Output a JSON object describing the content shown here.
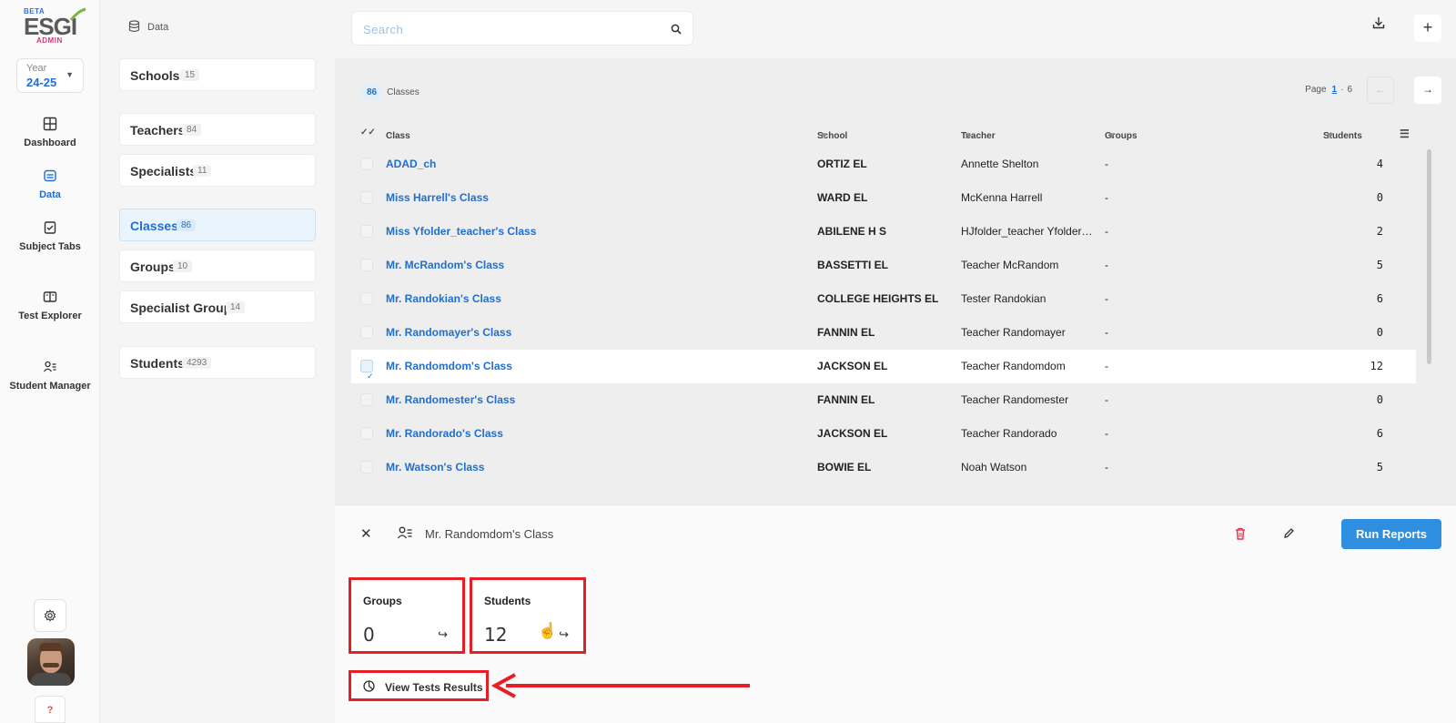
{
  "app": {
    "logo_beta": "BETA",
    "logo_name": "ESGI",
    "logo_admin": "ADMIN",
    "year_label": "Year",
    "year_value": "24-25"
  },
  "nav": {
    "items": [
      {
        "label": "Dashboard",
        "icon": "grid-icon"
      },
      {
        "label": "Data",
        "icon": "data-icon",
        "active": true
      },
      {
        "label": "Subject Tabs",
        "icon": "checklist-icon"
      },
      {
        "label": "Test Explorer",
        "icon": "book-icon"
      },
      {
        "label": "Student Manager",
        "icon": "student-manager-icon"
      }
    ],
    "help_label": "?"
  },
  "data_panel": {
    "title": "Data",
    "items": [
      {
        "label": "Schools",
        "count": "15"
      },
      {
        "label": "Teachers",
        "count": "84"
      },
      {
        "label": "Specialists",
        "count": "11"
      },
      {
        "label": "Classes",
        "count": "86",
        "active": true
      },
      {
        "label": "Groups",
        "count": "10"
      },
      {
        "label": "Specialist Groups",
        "count": "14"
      },
      {
        "label": "Students",
        "count": "4293"
      }
    ]
  },
  "search": {
    "placeholder": "Search"
  },
  "table": {
    "count": "86",
    "count_label": "Classes",
    "page_label": "Page",
    "page_current": "1",
    "page_total": "6",
    "columns": {
      "class": "Class",
      "school": "School",
      "teacher": "Teacher",
      "groups": "Groups",
      "students": "Students"
    },
    "rows": [
      {
        "class": "ADAD_ch",
        "school": "ORTIZ EL",
        "teacher": "Annette Shelton",
        "groups": "-",
        "students": "4"
      },
      {
        "class": "Miss Harrell's Class",
        "school": "WARD EL",
        "teacher": "McKenna Harrell",
        "groups": "-",
        "students": "0"
      },
      {
        "class": "Miss Yfolder_teacher's Class",
        "school": "ABILENE H S",
        "teacher": "HJfolder_teacher Yfolder_teacher",
        "groups": "-",
        "students": "2"
      },
      {
        "class": "Mr. McRandom's Class",
        "school": "BASSETTI EL",
        "teacher": "Teacher McRandom",
        "groups": "-",
        "students": "5"
      },
      {
        "class": "Mr. Randokian's Class",
        "school": "COLLEGE HEIGHTS EL",
        "teacher": "Tester Randokian",
        "groups": "-",
        "students": "6"
      },
      {
        "class": "Mr. Randomayer's Class",
        "school": "FANNIN EL",
        "teacher": "Teacher Randomayer",
        "groups": "-",
        "students": "0"
      },
      {
        "class": "Mr. Randomdom's Class",
        "school": "JACKSON EL",
        "teacher": "Teacher Randomdom",
        "groups": "-",
        "students": "12",
        "selected": true
      },
      {
        "class": "Mr. Randomester's Class",
        "school": "FANNIN EL",
        "teacher": "Teacher Randomester",
        "groups": "-",
        "students": "0"
      },
      {
        "class": "Mr. Randorado's Class",
        "school": "JACKSON EL",
        "teacher": "Teacher Randorado",
        "groups": "-",
        "students": "6"
      },
      {
        "class": "Mr. Watson's Class",
        "school": "BOWIE EL",
        "teacher": "Noah Watson",
        "groups": "-",
        "students": "5"
      }
    ]
  },
  "detail": {
    "title": "Mr. Randomdom's Class",
    "run_reports_label": "Run Reports",
    "groups_label": "Groups",
    "groups_value": "0",
    "students_label": "Students",
    "students_value": "12",
    "view_results_label": "View Tests Results"
  },
  "colors": {
    "accent": "#1f6fd0",
    "primary_button": "#2e8fe0",
    "highlight_box": "#e41f26",
    "delete_icon": "#e0334a"
  }
}
